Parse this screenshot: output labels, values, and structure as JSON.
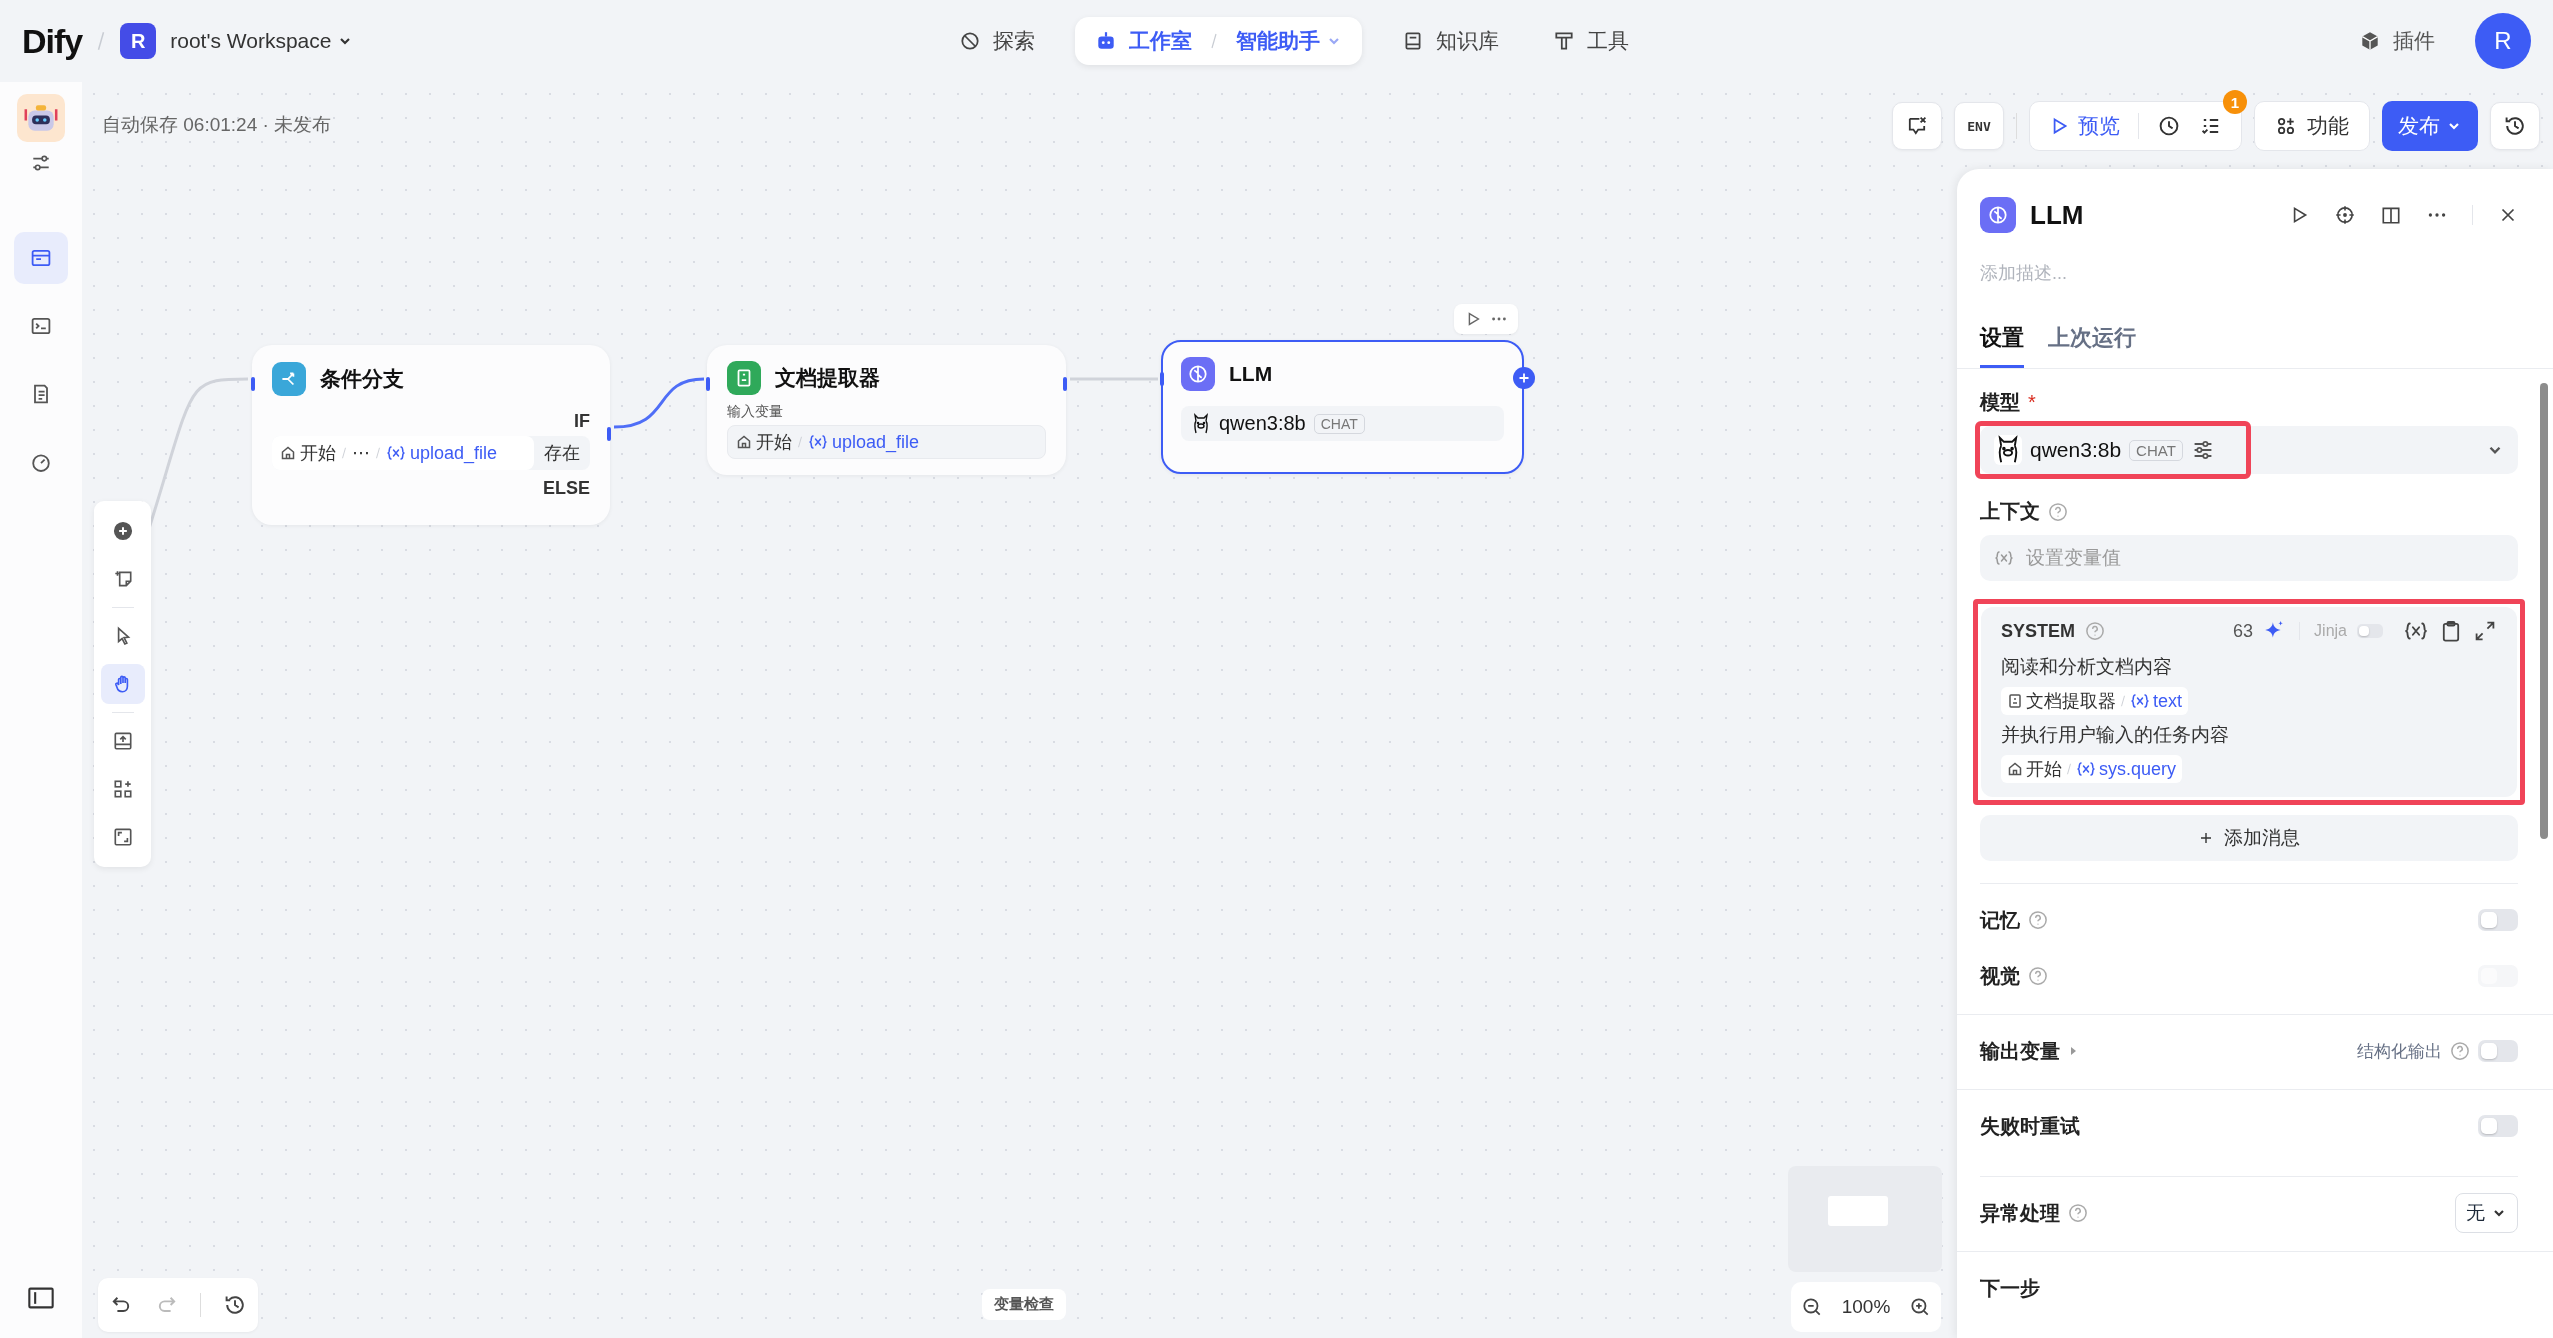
{
  "header": {
    "logo": "Dify",
    "workspace_initial": "R",
    "workspace": "root's Workspace",
    "nav": [
      {
        "kind": "explore",
        "label": "探索",
        "selected": false
      },
      {
        "kind": "studio",
        "label": "工作室",
        "selected": true,
        "sub": "智能助手"
      },
      {
        "kind": "knowledge",
        "label": "知识库",
        "selected": false
      },
      {
        "kind": "tools",
        "label": "工具",
        "selected": false
      }
    ],
    "plugins": "插件",
    "avatar": "R"
  },
  "app_sidebar": {
    "items": [
      {
        "kind": "workflow",
        "selected": true
      },
      {
        "kind": "terminal",
        "selected": false
      },
      {
        "kind": "logs",
        "selected": false
      },
      {
        "kind": "monitor",
        "selected": false
      }
    ]
  },
  "autosave": "自动保存 06:01:24 · 未发布",
  "canvas_toolbar": {
    "env": "ENV",
    "preview": "预览",
    "checklist_badge": "1",
    "features": "功能",
    "publish": "发布"
  },
  "tools": [
    {
      "kind": "add",
      "selected": false
    },
    {
      "kind": "note",
      "selected": false
    },
    {
      "kind": "pointer",
      "selected": false
    },
    {
      "kind": "hand",
      "selected": true
    },
    {
      "kind": "export",
      "selected": false
    },
    {
      "kind": "organize",
      "selected": false
    },
    {
      "kind": "fit",
      "selected": false
    }
  ],
  "nodes": [
    {
      "kind": "if_else",
      "title": "条件分支",
      "if_label": "IF",
      "else_label": "ELSE",
      "condition": {
        "source": "开始",
        "ellipsis": "⋯",
        "variable": "upload_file",
        "operator": "存在"
      }
    },
    {
      "kind": "doc_extractor",
      "title": "文档提取器",
      "input_label": "输入变量",
      "variable": {
        "source": "开始",
        "name": "upload_file"
      }
    },
    {
      "kind": "llm",
      "title": "LLM",
      "selected": true,
      "model": "qwen3:8b",
      "model_tag": "CHAT"
    }
  ],
  "panel": {
    "title": "LLM",
    "description_placeholder": "添加描述...",
    "tabs": [
      {
        "label": "设置",
        "selected": true
      },
      {
        "label": "上次运行",
        "selected": false
      }
    ],
    "model": {
      "label": "模型",
      "required_mark": "*",
      "name": "qwen3:8b",
      "tag": "CHAT",
      "highlighted": true
    },
    "context": {
      "label": "上下文",
      "placeholder": "设置变量值"
    },
    "system": {
      "role": "SYSTEM",
      "count": "63",
      "jinja_label": "Jinja",
      "jinja_on": false,
      "highlighted": true,
      "lines": [
        {
          "kind": "text",
          "text": "阅读和分析文档内容"
        },
        {
          "kind": "var",
          "source": {
            "kind": "doc",
            "label": "文档提取器"
          },
          "name": "text"
        },
        {
          "kind": "text",
          "text": "并执行用户输入的任务内容"
        },
        {
          "kind": "var",
          "source": {
            "kind": "start",
            "label": "开始"
          },
          "name": "sys.query"
        }
      ]
    },
    "add_message": "添加消息",
    "toggles": [
      {
        "label": "记忆",
        "on": false,
        "disabled": false
      },
      {
        "label": "视觉",
        "on": false,
        "disabled": true
      }
    ],
    "output": {
      "label": "输出变量",
      "structured_label": "结构化输出",
      "structured_on": false
    },
    "retry": {
      "label": "失败时重试",
      "on": false
    },
    "error_handling": {
      "label": "异常处理",
      "value": "无"
    },
    "next_step": "下一步"
  },
  "variable_inspect": "变量检查",
  "zoom": "100%"
}
